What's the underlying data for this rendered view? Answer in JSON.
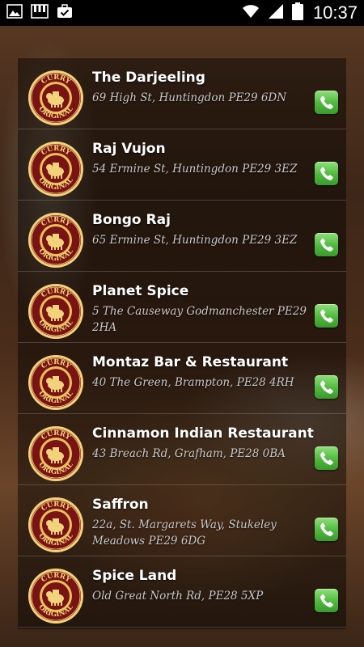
{
  "status_bar": {
    "time": "10:37",
    "icons_left": [
      "image-icon",
      "piano-icon",
      "briefcase-check-icon"
    ],
    "icons_right": [
      "wifi-icon",
      "signal-icon",
      "battery-icon"
    ]
  },
  "colors": {
    "logo_ring": "#f2d27a",
    "logo_center": "#7a1414",
    "call_green": "#4fb83e"
  },
  "logo_text": {
    "top": "CURRY",
    "bottom": "ORIGINAL"
  },
  "restaurants": [
    {
      "name": "The Darjeeling",
      "address": "69 High St, Huntingdon PE29 6DN"
    },
    {
      "name": "Raj Vujon",
      "address": "54 Ermine St, Huntingdon PE29 3EZ"
    },
    {
      "name": "Bongo Raj",
      "address": "65 Ermine St, Huntingdon PE29 3EZ"
    },
    {
      "name": "Planet Spice",
      "address": "5 The Causeway Godmanchester PE29 2HA"
    },
    {
      "name": "Montaz Bar & Restaurant",
      "address": "40 The Green, Brampton, PE28 4RH"
    },
    {
      "name": "Cinnamon Indian Restaurant",
      "address": "43 Breach Rd, Grafham, PE28 0BA"
    },
    {
      "name": "Saffron",
      "address": "22a, St. Margarets Way, Stukeley Meadows PE29 6DG"
    },
    {
      "name": "Spice Land",
      "address": "Old Great North Rd, PE28 5XP"
    }
  ]
}
